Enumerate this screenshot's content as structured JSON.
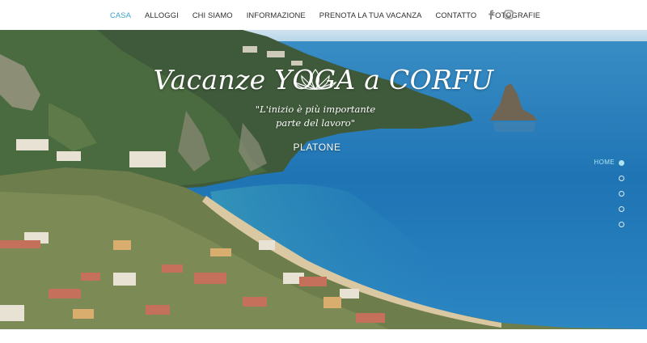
{
  "nav": {
    "items": [
      {
        "label": "CASA",
        "active": true
      },
      {
        "label": "ALLOGGI"
      },
      {
        "label": "CHI SIAMO"
      },
      {
        "label": "INFORMAZIONE"
      },
      {
        "label": "PRENOTA LA TUA VACANZA"
      },
      {
        "label": "CONTATTO"
      },
      {
        "label": "FOTOGRAFIE"
      }
    ],
    "active_color": "#3aa3c9"
  },
  "social": {
    "facebook_icon": "facebook-icon",
    "instagram_icon": "instagram-icon"
  },
  "hero": {
    "logo_icon": "lotus-icon",
    "title": "Vacanze YOGA a CORFU",
    "quote_line1": "\"L'inizio è più importante",
    "quote_line2": "parte del lavoro\"",
    "author": "PLATONE"
  },
  "slider": {
    "active_label": "HOME",
    "dot_count": 5
  }
}
